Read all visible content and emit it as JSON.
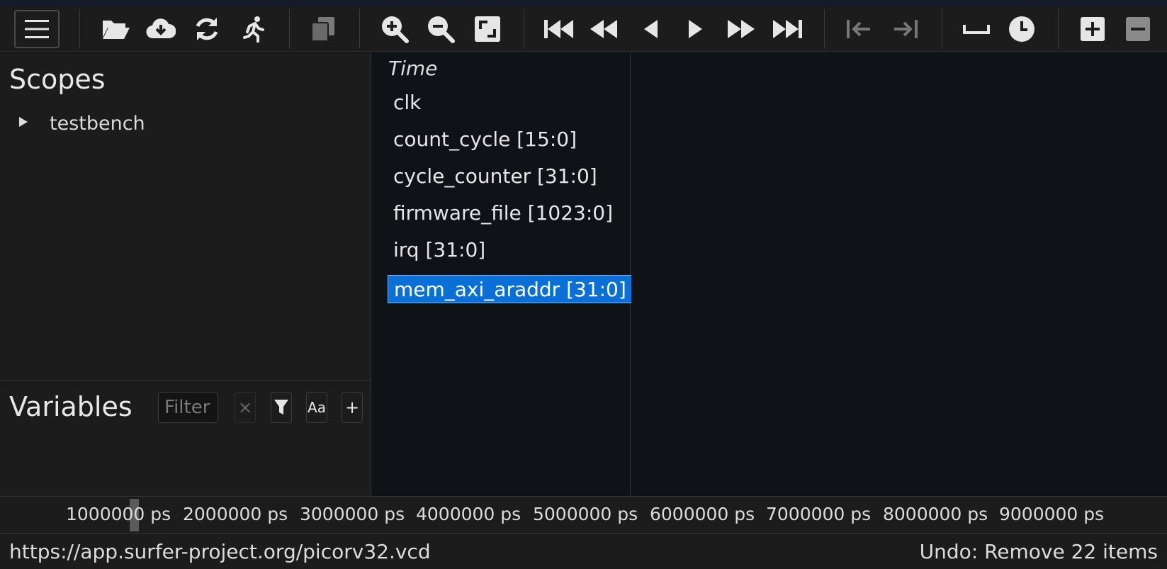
{
  "toolbar": {
    "buttons": [
      {
        "name": "menu-icon"
      },
      {
        "name": "open-folder-icon"
      },
      {
        "name": "download-cloud-icon"
      },
      {
        "name": "reload-icon"
      },
      {
        "name": "run-icon"
      },
      {
        "name": "copy-icon"
      },
      {
        "name": "zoom-in-icon"
      },
      {
        "name": "zoom-out-icon"
      },
      {
        "name": "zoom-fit-icon"
      },
      {
        "name": "goto-start-icon"
      },
      {
        "name": "fast-backward-icon"
      },
      {
        "name": "step-backward-icon"
      },
      {
        "name": "step-forward-icon"
      },
      {
        "name": "fast-forward-icon"
      },
      {
        "name": "goto-end-icon"
      },
      {
        "name": "prev-transition-icon"
      },
      {
        "name": "next-transition-icon"
      },
      {
        "name": "space-icon"
      },
      {
        "name": "clock-icon"
      },
      {
        "name": "add-icon"
      },
      {
        "name": "remove-icon"
      }
    ]
  },
  "scopes": {
    "title": "Scopes",
    "items": [
      {
        "label": "testbench"
      }
    ]
  },
  "variables": {
    "title": "Variables",
    "filter_placeholder": "Filter",
    "clear_label": "×",
    "case_label": "Aa",
    "add_label": "+"
  },
  "signals": {
    "header": "Time",
    "items": [
      {
        "label": "clk"
      },
      {
        "label": "count_cycle [15:0]"
      },
      {
        "label": "cycle_counter [31:0]"
      },
      {
        "label": "firmware_file [1023:0]"
      },
      {
        "label": "irq [31:0]"
      },
      {
        "label": "mem_axi_araddr [31:0]"
      }
    ],
    "selected": "mem_axi_araddr [31:0]"
  },
  "timeline": {
    "ticks": [
      "1000000 ps",
      "2000000 ps",
      "3000000 ps",
      "4000000 ps",
      "5000000 ps",
      "6000000 ps",
      "7000000 ps",
      "8000000 ps",
      "9000000 ps"
    ]
  },
  "status": {
    "url": "https://app.surfer-project.org/picorv32.vcd",
    "undo": "Undo: Remove 22 items"
  },
  "colors": {
    "accent": "#0a6fd6",
    "panel": "#1c1c1c",
    "background": "#0f1318"
  }
}
